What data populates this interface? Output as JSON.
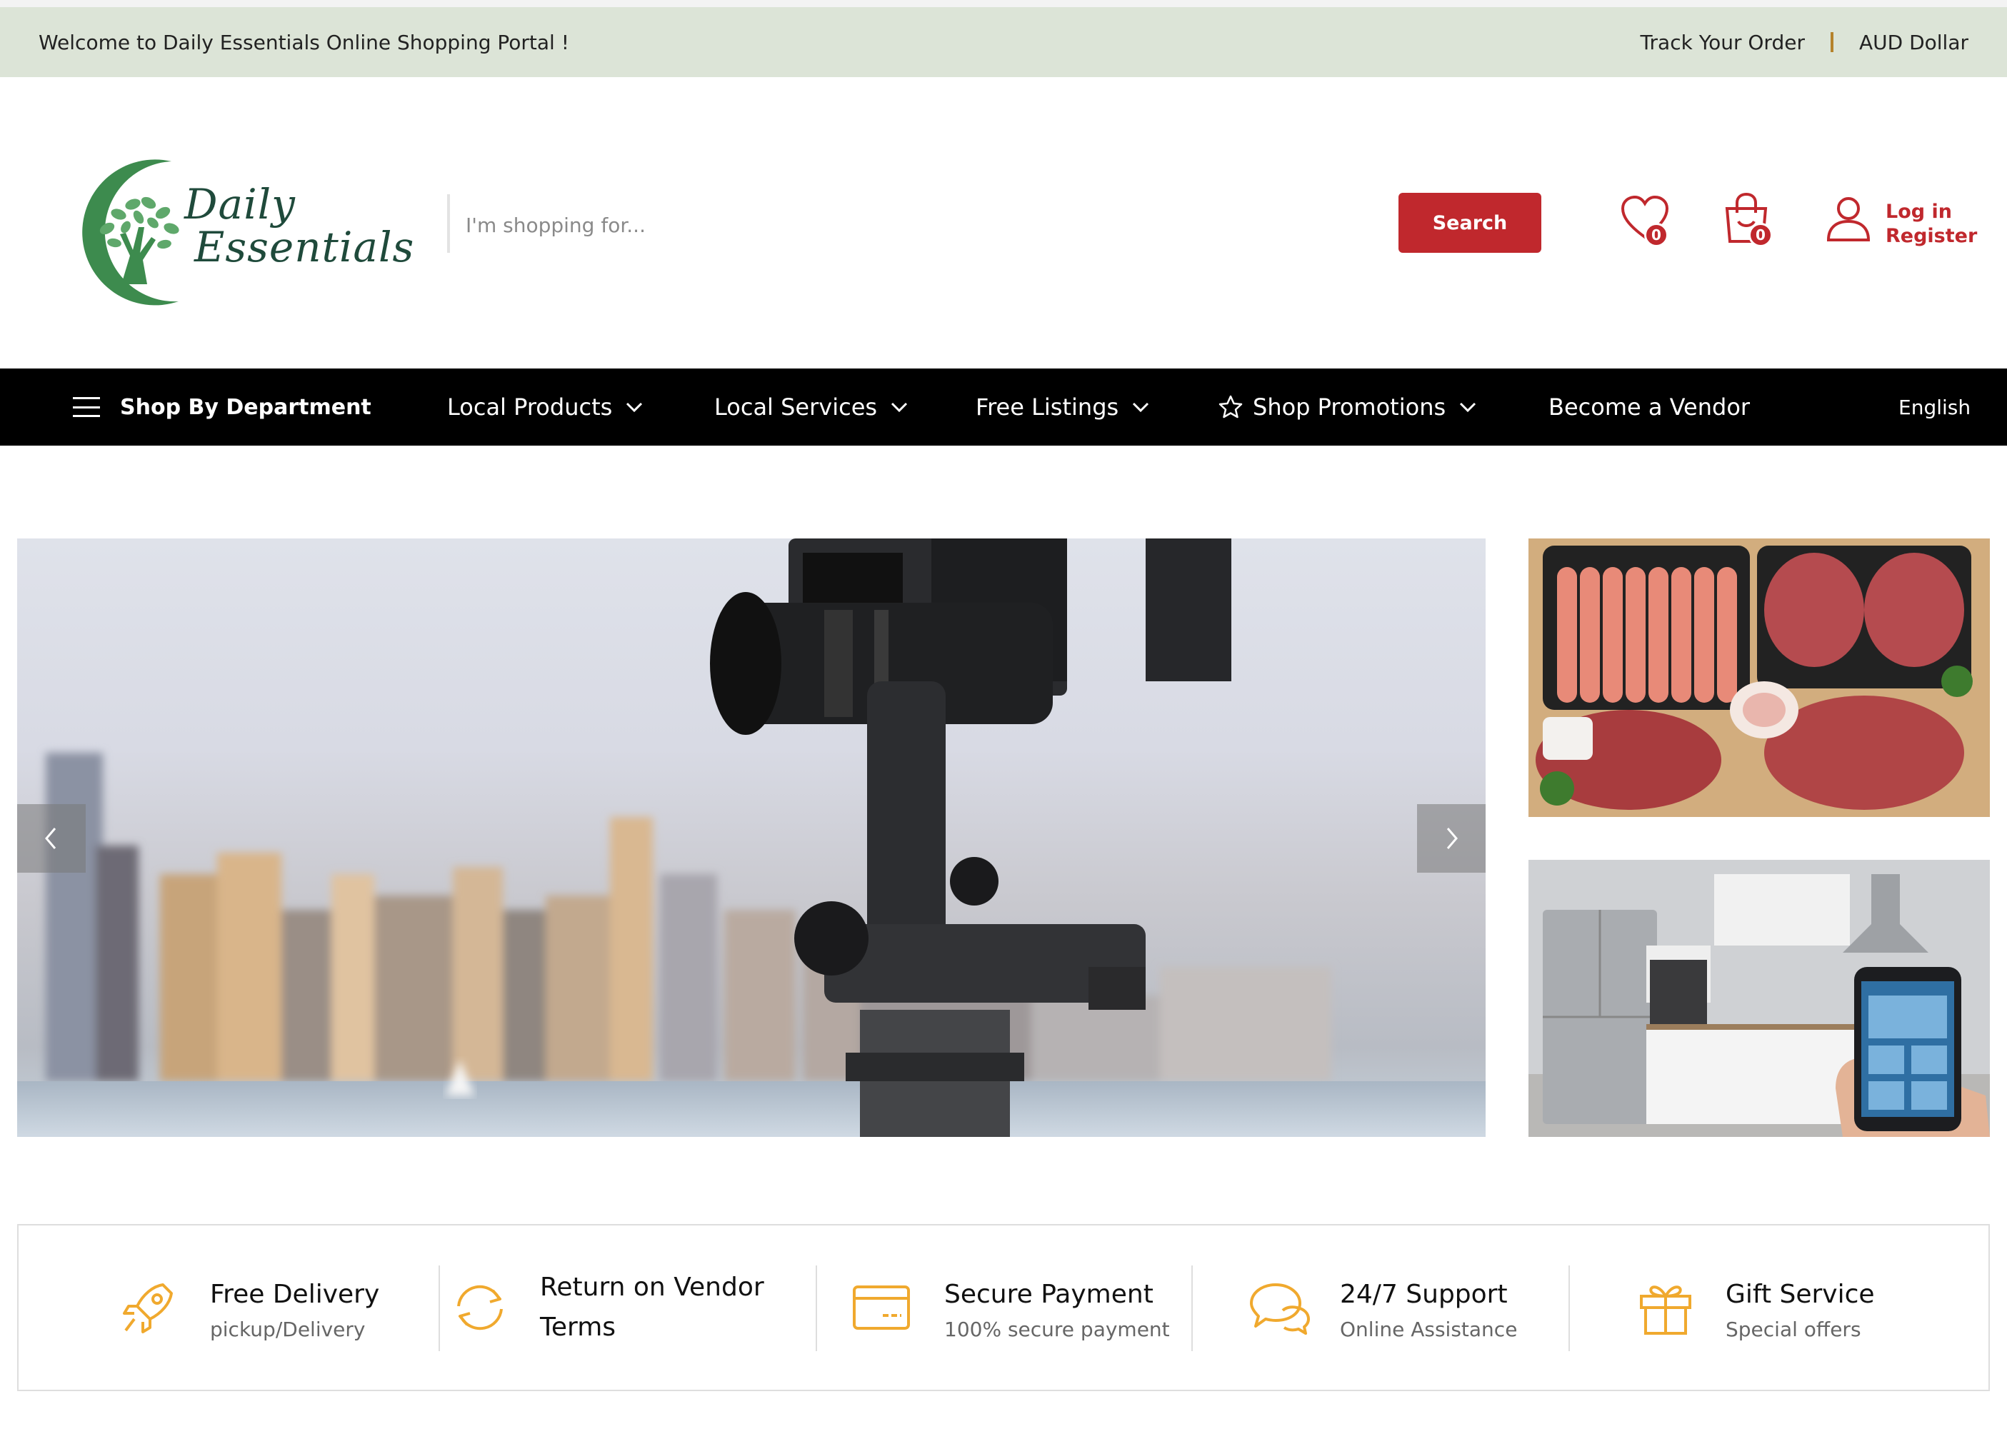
{
  "topbar": {
    "welcome": "Welcome to Daily Essentials Online Shopping Portal !",
    "track_order": "Track Your Order",
    "currency": "AUD Dollar"
  },
  "header": {
    "logo_line1": "Daily",
    "logo_line2": "Essentials",
    "search_placeholder": "I'm shopping for...",
    "search_button": "Search",
    "wishlist_count": "0",
    "cart_count": "0",
    "login": "Log in",
    "register": "Register"
  },
  "nav": {
    "department": "Shop By Department",
    "items": [
      "Local Products",
      "Local Services",
      "Free Listings",
      "Shop Promotions",
      "Become a Vendor"
    ],
    "language": "English"
  },
  "features": [
    {
      "title": "Free Delivery",
      "subtitle": "pickup/Delivery",
      "icon": "rocket-icon"
    },
    {
      "title": "Return on Vendor Terms",
      "subtitle": "",
      "icon": "refresh-icon"
    },
    {
      "title": "Secure Payment",
      "subtitle": "100% secure payment",
      "icon": "credit-card-icon"
    },
    {
      "title": "24/7 Support",
      "subtitle": "Online Assistance",
      "icon": "chat-icon"
    },
    {
      "title": "Gift Service",
      "subtitle": "Special offers",
      "icon": "gift-icon"
    }
  ],
  "colors": {
    "accent_red": "#c0282d",
    "topbar_bg": "#dce4d7",
    "nav_bg": "#000000",
    "feature_icon": "#f0a92e",
    "logo_green": "#3d8b4e"
  }
}
